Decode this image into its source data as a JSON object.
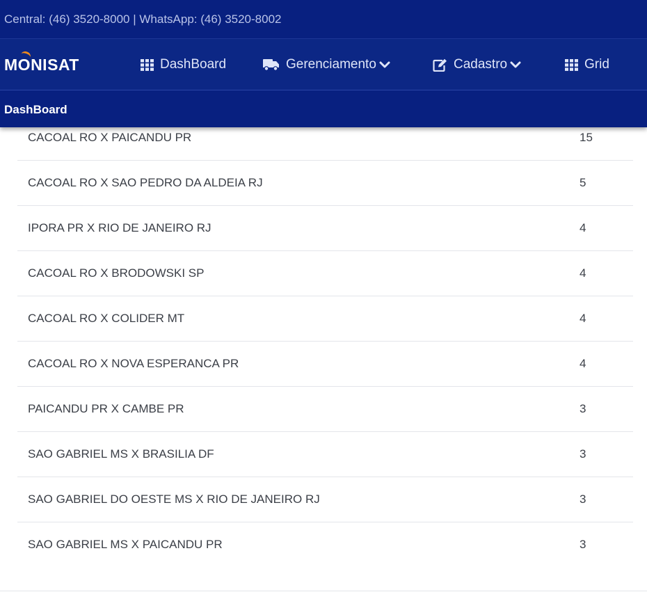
{
  "topbar": {
    "contact": "Central: (46) 3520-8000 | WhatsApp: (46) 3520-8002"
  },
  "brand": {
    "prefix": "M",
    "o": "O",
    "suffix": "NISAT",
    "accent_color": "#f08a1c"
  },
  "nav": {
    "items": [
      {
        "label": "DashBoard",
        "icon": "grid-icon"
      },
      {
        "label": "Gerenciamento",
        "icon": "truck-icon",
        "dropdown": true
      },
      {
        "label": "Cadastro",
        "icon": "edit-icon",
        "dropdown": true
      },
      {
        "label": "Grid",
        "icon": "grid-icon"
      }
    ]
  },
  "breadcrumb": {
    "current": "DashBoard"
  },
  "routes": [
    {
      "route": "CACOAL RO X PAICANDU PR",
      "count": "15"
    },
    {
      "route": "CACOAL RO X SAO PEDRO DA ALDEIA RJ",
      "count": "5"
    },
    {
      "route": "IPORA PR X RIO DE JANEIRO RJ",
      "count": "4"
    },
    {
      "route": "CACOAL RO X BRODOWSKI SP",
      "count": "4"
    },
    {
      "route": "CACOAL RO X COLIDER MT",
      "count": "4"
    },
    {
      "route": "CACOAL RO X NOVA ESPERANCA PR",
      "count": "4"
    },
    {
      "route": "PAICANDU PR X CAMBE PR",
      "count": "3"
    },
    {
      "route": "SAO GABRIEL MS X BRASILIA DF",
      "count": "3"
    },
    {
      "route": "SAO GABRIEL DO OESTE MS X RIO DE JANEIRO RJ",
      "count": "3"
    },
    {
      "route": "SAO GABRIEL MS X PAICANDU PR",
      "count": "3"
    }
  ],
  "colors": {
    "header_bg": "#082080",
    "navbar_bg": "#0c2785",
    "text": "#3b3f47"
  }
}
